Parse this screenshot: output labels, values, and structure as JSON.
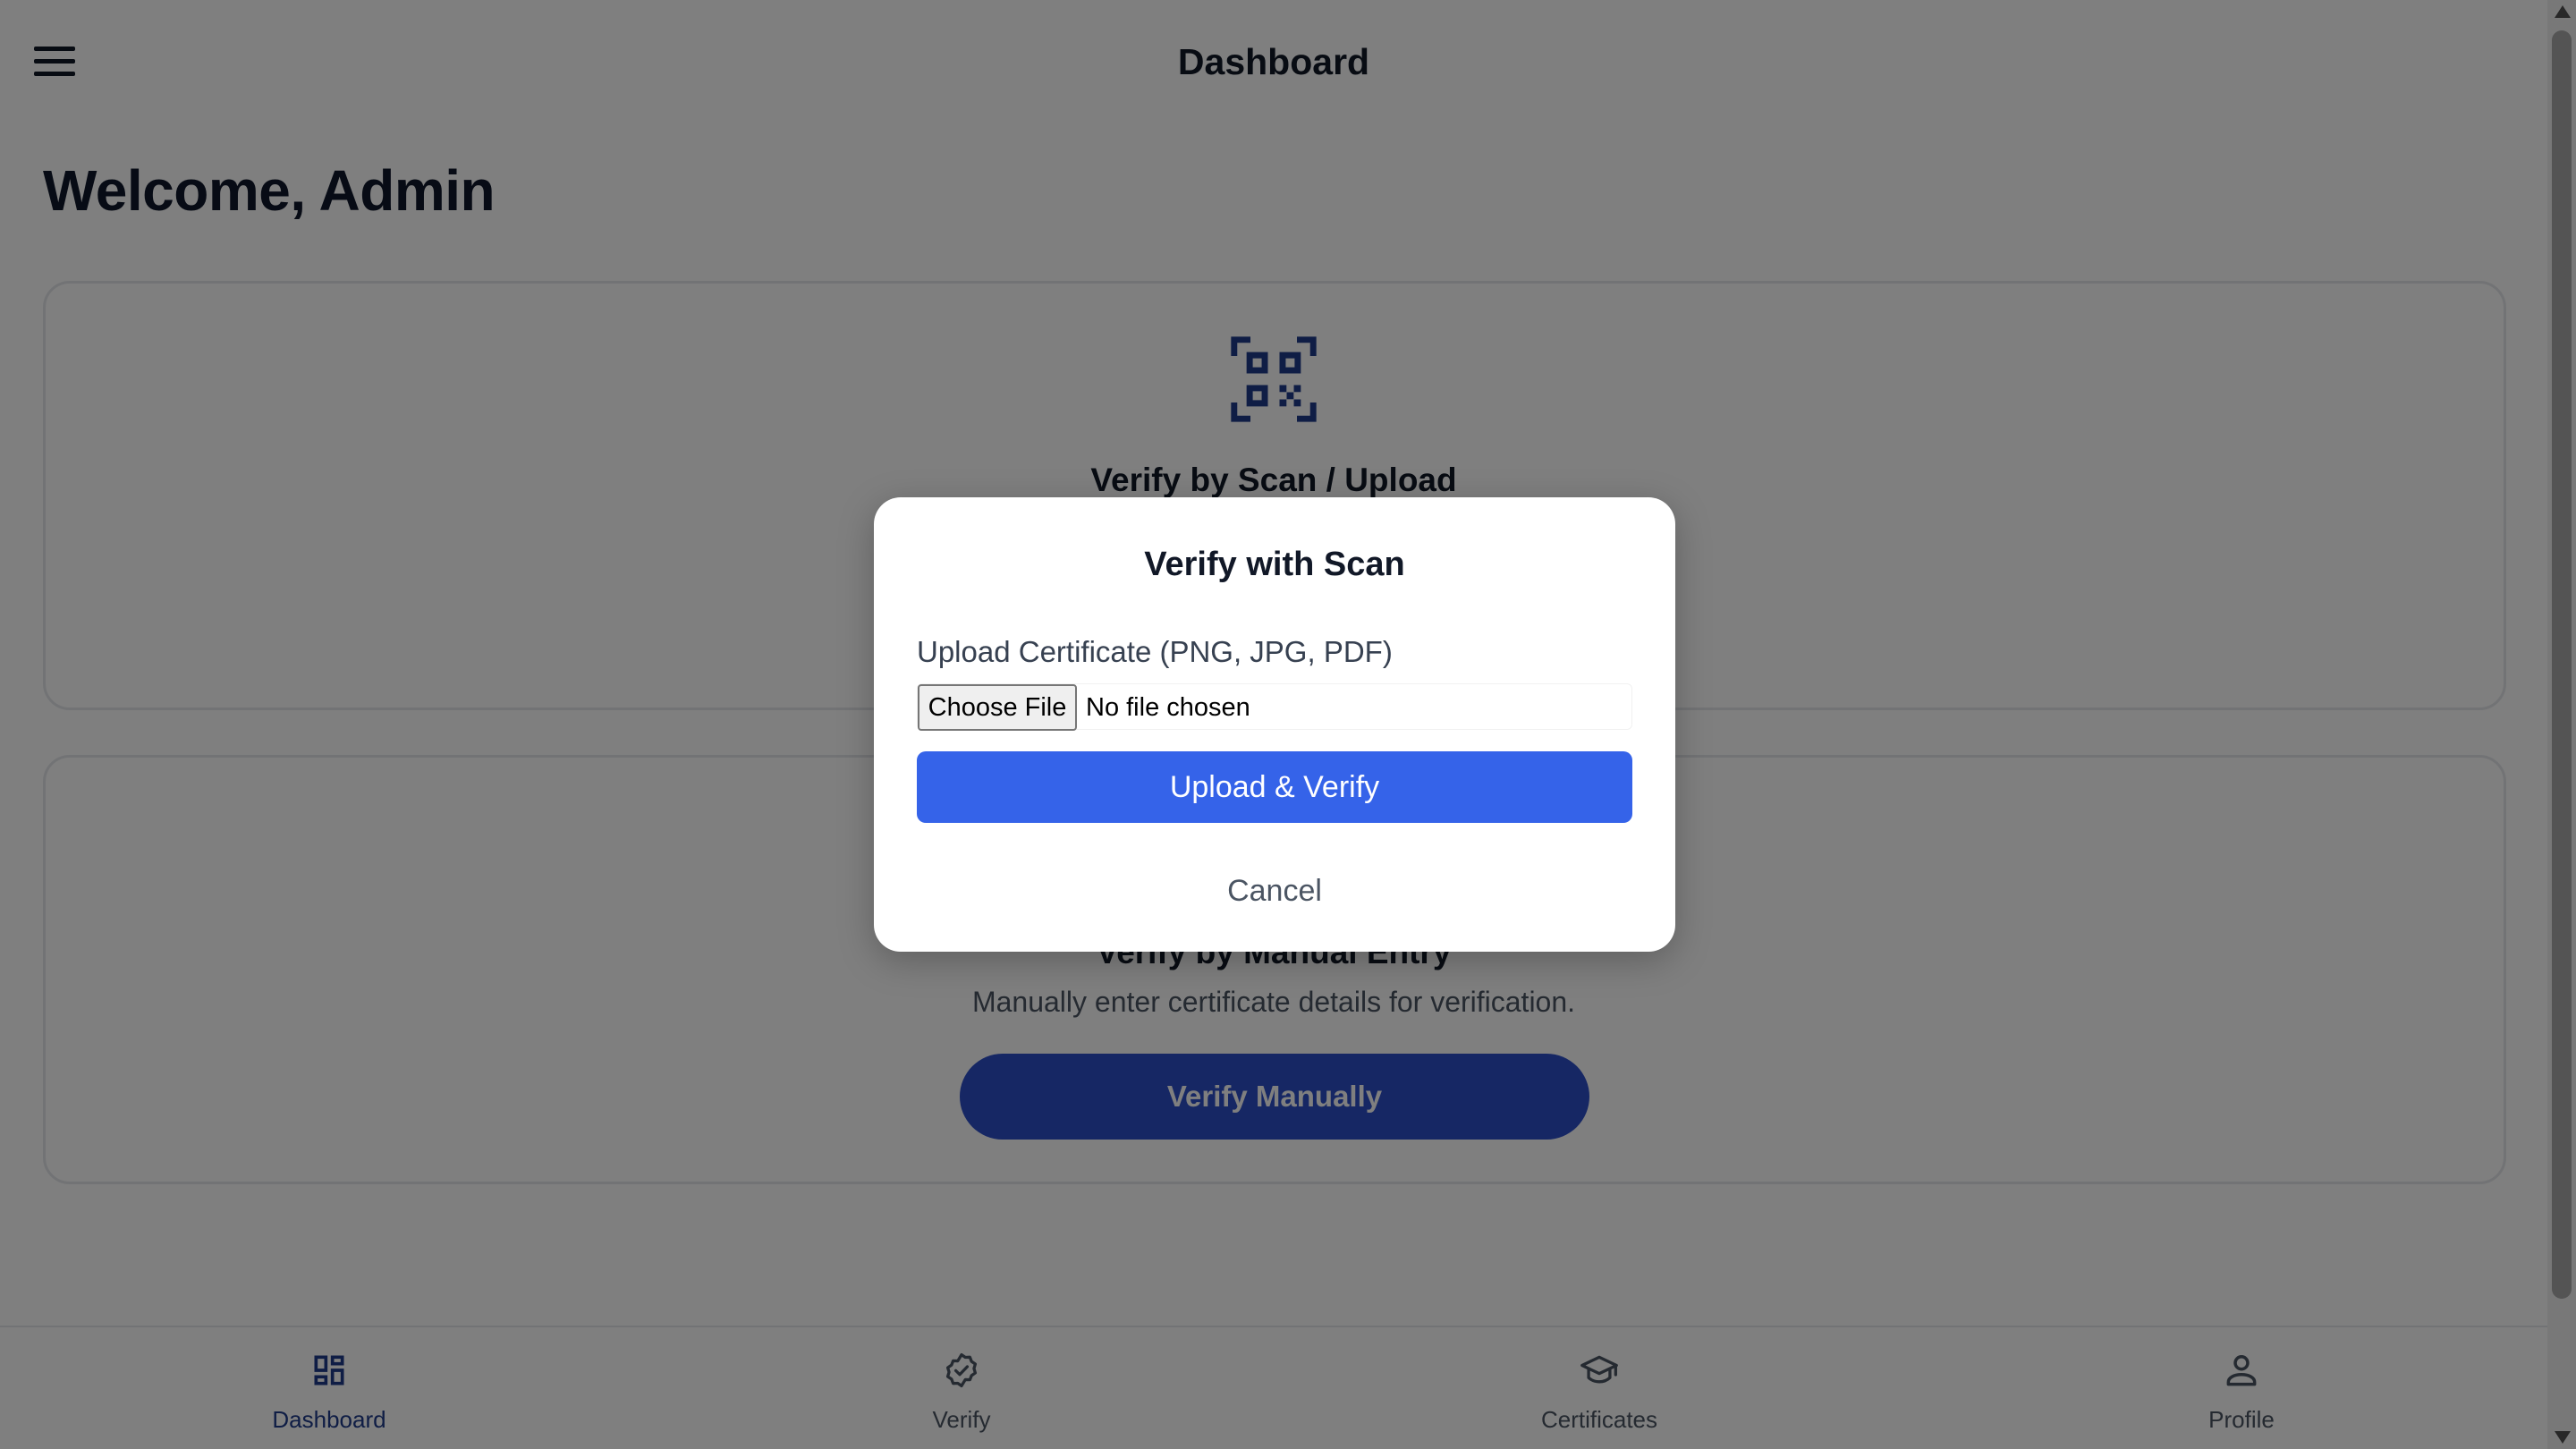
{
  "header": {
    "title": "Dashboard"
  },
  "welcome": "Welcome, Admin",
  "cards": [
    {
      "title": "Verify by Scan / Upload",
      "icon": "qr-scan-icon"
    },
    {
      "title": "Verify by Manual Entry",
      "description": "Manually enter certificate details for verification.",
      "button": "Verify Manually"
    }
  ],
  "modal": {
    "title": "Verify with Scan",
    "upload_label": "Upload Certificate (PNG, JPG, PDF)",
    "choose_file": "Choose File",
    "file_status": "No file chosen",
    "submit": "Upload & Verify",
    "cancel": "Cancel"
  },
  "bottom_nav": {
    "items": [
      {
        "label": "Dashboard",
        "icon": "dashboard-icon",
        "active": true
      },
      {
        "label": "Verify",
        "icon": "verified-badge-icon",
        "active": false
      },
      {
        "label": "Certificates",
        "icon": "graduation-cap-icon",
        "active": false
      },
      {
        "label": "Profile",
        "icon": "person-icon",
        "active": false
      }
    ]
  },
  "colors": {
    "primary": "#3563e9",
    "primary_dark": "#2d4ec9",
    "icon_blue": "#1e3a8a",
    "text": "#111827",
    "muted": "#4b5563"
  }
}
